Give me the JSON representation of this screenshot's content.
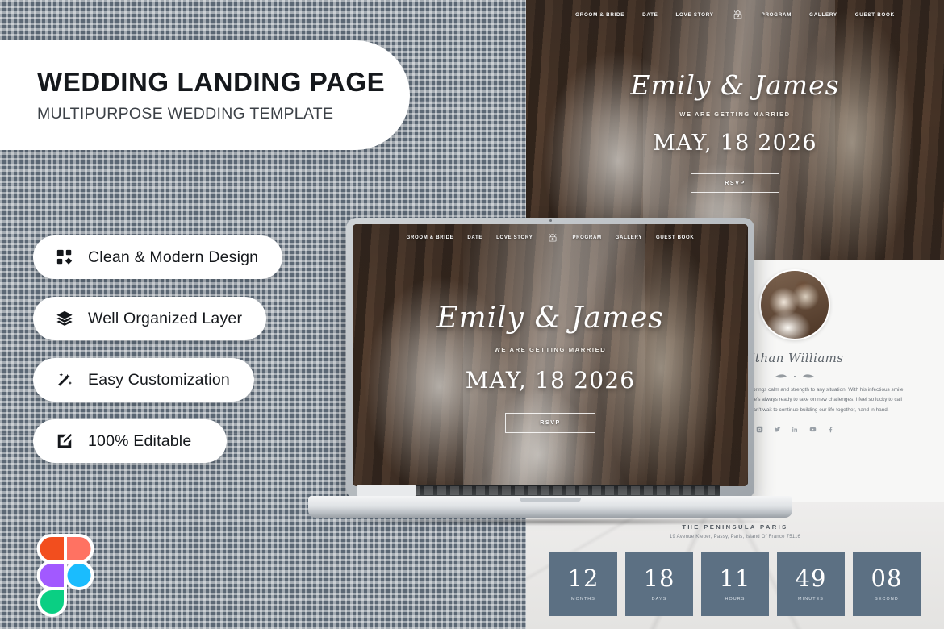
{
  "background": {
    "color": "#5c6875",
    "grid": "dashed-and-solid"
  },
  "title_card": {
    "title": "WEDDING LANDING PAGE",
    "subtitle": "MULTIPURPOSE WEDDING TEMPLATE"
  },
  "features": [
    {
      "icon": "grid-squares-icon",
      "label": "Clean & Modern Design"
    },
    {
      "icon": "layers-icon",
      "label": "Well Organized Layer"
    },
    {
      "icon": "magic-wand-icon",
      "label": "Easy Customization"
    },
    {
      "icon": "edit-square-icon",
      "label": "100% Editable"
    }
  ],
  "figma_logo": {
    "name": "figma-logo",
    "colors": {
      "orange": "#F24E1E",
      "salmon": "#FF7262",
      "purple": "#A259FF",
      "blue": "#1ABCFE",
      "green": "#0ACF83"
    }
  },
  "website": {
    "nav": {
      "items_left": [
        "GROOM & BRIDE",
        "DATE",
        "LOVE STORY"
      ],
      "logo": "monogram-crest-icon",
      "items_right": [
        "PROGRAM",
        "GALLERY",
        "GUEST BOOK"
      ]
    },
    "hero": {
      "names": "Emily & James",
      "tagline": "WE ARE GETTING MARRIED",
      "date": "MAY, 18 2026",
      "cta_label": "RSVP"
    },
    "about": {
      "avatar": "couple-portrait",
      "name": "Ethan Williams",
      "bio": "He is the kind of person who brings calm and strength to any situation. With his infectious smile and positive outlook on life, he's always ready to take on new challenges. I feel so lucky to call him my partner, and I can't wait to continue building our life together, hand in hand.",
      "socials": [
        "instagram-icon",
        "twitter-icon",
        "linkedin-icon",
        "youtube-icon",
        "facebook-icon"
      ]
    },
    "venue": {
      "name": "THE PENINSULA PARIS",
      "address": "19 Avenue Kleber, Passy, Paris, Island Of France 75116"
    },
    "countdown": [
      {
        "value": "12",
        "label": "MONTHS"
      },
      {
        "value": "18",
        "label": "DAYS"
      },
      {
        "value": "11",
        "label": "HOURS"
      },
      {
        "value": "49",
        "label": "MINUTES"
      },
      {
        "value": "08",
        "label": "SECOND"
      }
    ],
    "accent_color": "#5c7083"
  },
  "laptop": {
    "name": "macbook-mockup"
  }
}
